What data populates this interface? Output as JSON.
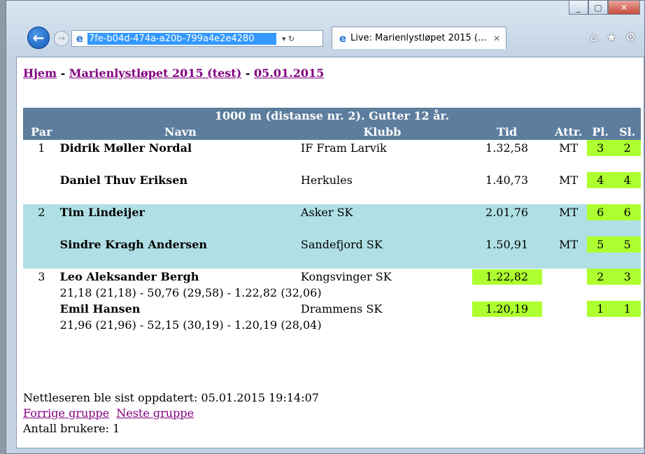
{
  "browser": {
    "url": "7fe-b04d-474a-a20b-799a4e2e4280",
    "tab_title": "Live: Marienlystløpet 2015 (...",
    "back_glyph": "←",
    "forward_glyph": "→",
    "ie_glyph": "e",
    "addr_controls": "▾ ↻",
    "tab_close": "✕",
    "home_glyph": "⌂",
    "star_glyph": "★",
    "gear_glyph": "⚙",
    "minimize_glyph": "_",
    "maximize_glyph": "▢",
    "close_glyph": "✕"
  },
  "breadcrumb": {
    "home": "Hjem",
    "sep": " - ",
    "event": "Marienlystløpet 2015 (test)",
    "date": "05.01.2015"
  },
  "table": {
    "caption": "1000 m (distanse nr. 2). Gutter 12 år.",
    "headers": {
      "par": "Par",
      "name": "Navn",
      "club": "Klubb",
      "time": "Tid",
      "attr": "Attr.",
      "pl": "Pl.",
      "sl": "Sl."
    },
    "rows": [
      {
        "par": "1",
        "name": "Didrik Møller Nordal",
        "club": "IF Fram Larvik",
        "time": "1.32,58",
        "attr": "MT",
        "pl": "3",
        "sl": "2"
      },
      {
        "par": "",
        "name": "Daniel Thuv Eriksen",
        "club": "Herkules",
        "time": "1.40,73",
        "attr": "MT",
        "pl": "4",
        "sl": "4"
      },
      {
        "par": "2",
        "name": "Tim Lindeijer",
        "club": "Asker SK",
        "time": "2.01,76",
        "attr": "MT",
        "pl": "6",
        "sl": "6"
      },
      {
        "par": "",
        "name": "Sindre Kragh Andersen",
        "club": "Sandefjord SK",
        "time": "1.50,91",
        "attr": "MT",
        "pl": "5",
        "sl": "5"
      },
      {
        "par": "3",
        "name": "Leo Aleksander Bergh",
        "club": "Kongsvinger SK",
        "time": "1.22,82",
        "attr": "",
        "pl": "2",
        "sl": "3",
        "splits": "21,18 (21,18) - 50,76 (29,58) - 1.22,82 (32,06)"
      },
      {
        "par": "",
        "name": "Emil Hansen",
        "club": "Drammens SK",
        "time": "1.20,19",
        "attr": "",
        "pl": "1",
        "sl": "1",
        "splits": "21,96 (21,96) - 52,15 (30,19) - 1.20,19 (28,04)"
      }
    ]
  },
  "footer": {
    "updated": "Nettleseren ble sist oppdatert: 05.01.2015 19:14:07",
    "prev": "Forrige gruppe",
    "next": "Neste gruppe",
    "users": "Antall brukere: 1"
  }
}
